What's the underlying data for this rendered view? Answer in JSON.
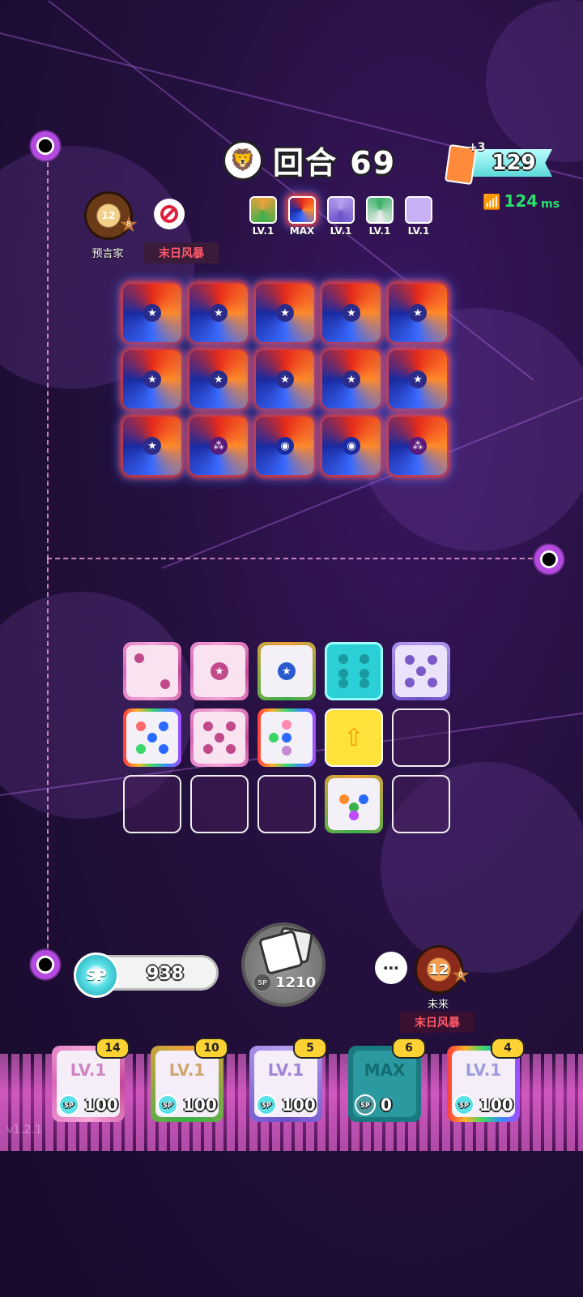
{
  "hud": {
    "round_label": "回合 69",
    "sp_top": "129",
    "sp_top_bonus": "+3",
    "ping_value": "124",
    "ping_unit": "ms"
  },
  "opponent": {
    "badge_rank": "12",
    "badge_star": "8",
    "name": "预言家",
    "mode": "末日风暴",
    "deck_levels": [
      "LV.1",
      "MAX",
      "LV.1",
      "LV.1",
      "LV.1"
    ]
  },
  "player": {
    "badge_rank": "12",
    "badge_star": "8",
    "name": "未来",
    "mode": "末日风暴",
    "sp": "938",
    "roll_cost": "1210",
    "sp_icon": "SP",
    "chat_icon": "⋯"
  },
  "deck": [
    {
      "level": "LV.1",
      "count": "14",
      "cost": "100"
    },
    {
      "level": "LV.1",
      "count": "10",
      "cost": "100"
    },
    {
      "level": "LV.1",
      "count": "5",
      "cost": "100"
    },
    {
      "level": "MAX",
      "count": "6",
      "cost": "0"
    },
    {
      "level": "LV.1",
      "count": "4",
      "cost": "100"
    }
  ],
  "version": "v1.2.1"
}
